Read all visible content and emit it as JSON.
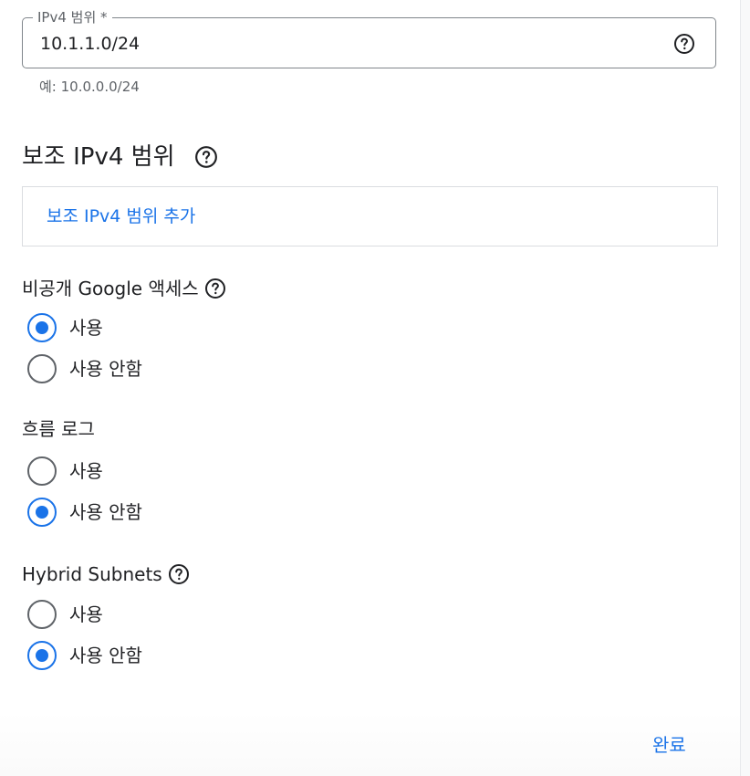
{
  "ipv4_range": {
    "label": "IPv4 범위 *",
    "value": "10.1.1.0/24",
    "hint": "예: 10.0.0.0/24",
    "help_icon": "help-circle-icon"
  },
  "secondary_ranges": {
    "heading": "보조 IPv4 범위",
    "add_link": "보조 IPv4 범위 추가",
    "help_icon": "help-circle-icon"
  },
  "private_google_access": {
    "label": "비공개 Google 액세스",
    "options": [
      "사용",
      "사용 안함"
    ],
    "selected": "사용"
  },
  "flow_logs": {
    "label": "흐름 로그",
    "options": [
      "사용",
      "사용 안함"
    ],
    "selected": "사용 안함"
  },
  "hybrid_subnets": {
    "label": "Hybrid Subnets",
    "options": [
      "사용",
      "사용 안함"
    ],
    "selected": "사용 안함"
  },
  "footer": {
    "done_label": "완료"
  },
  "colors": {
    "accent": "#1a73e8",
    "text": "#202124",
    "secondary_text": "#5f6368",
    "border": "#80868b"
  }
}
